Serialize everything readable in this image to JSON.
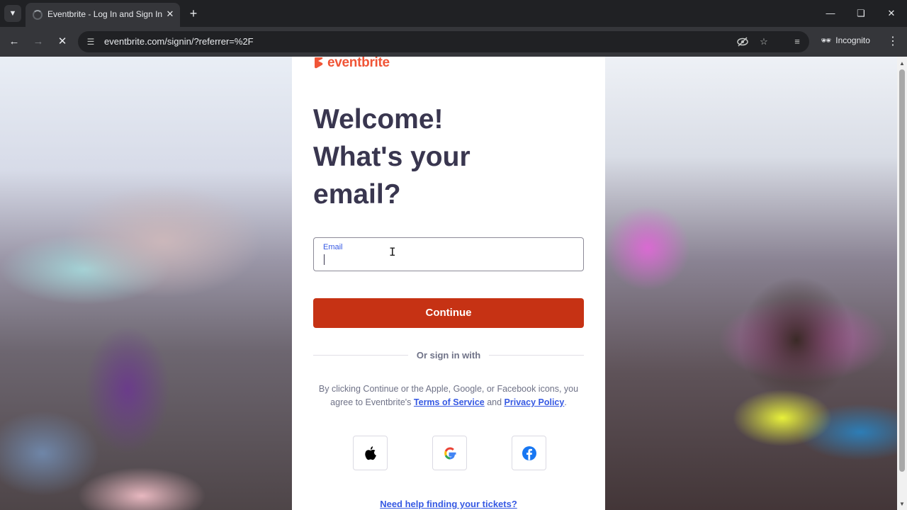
{
  "browser": {
    "tab_title": "Eventbrite - Log In and Sign In",
    "tab_close": "✕",
    "new_tab": "+",
    "url": "eventbrite.com/signin/?referrer=%2F",
    "incognito_label": "Incognito",
    "icons": {
      "tab_dropdown": "chevron-down-icon",
      "back": "back-arrow-icon",
      "forward": "forward-arrow-icon",
      "reload": "stop-loading-icon",
      "site_info": "site-info-icon",
      "eye_off": "eye-off-icon",
      "bookmark": "star-icon",
      "media": "media-control-icon",
      "incognito": "incognito-icon",
      "menu": "kebab-menu-icon"
    }
  },
  "page": {
    "brand": "eventbrite",
    "brand_color": "#f05537",
    "heading_line1": "Welcome!",
    "heading_line2": "What's your",
    "heading_line3": "email?",
    "email_label": "Email",
    "email_value": "",
    "continue_label": "Continue",
    "continue_color": "#c63214",
    "or_sign_in": "Or sign in with",
    "legal_pre": "By clicking Continue or the Apple, Google, or Facebook icons, you agree to Eventbrite's ",
    "terms_link": "Terms of Service",
    "legal_and": " and ",
    "privacy_link": "Privacy Policy",
    "legal_end": ".",
    "social": [
      "apple-icon",
      "google-icon",
      "facebook-icon"
    ],
    "help_link": "Need help finding your tickets?",
    "link_color": "#3659e3",
    "heading_color": "#39364f"
  }
}
